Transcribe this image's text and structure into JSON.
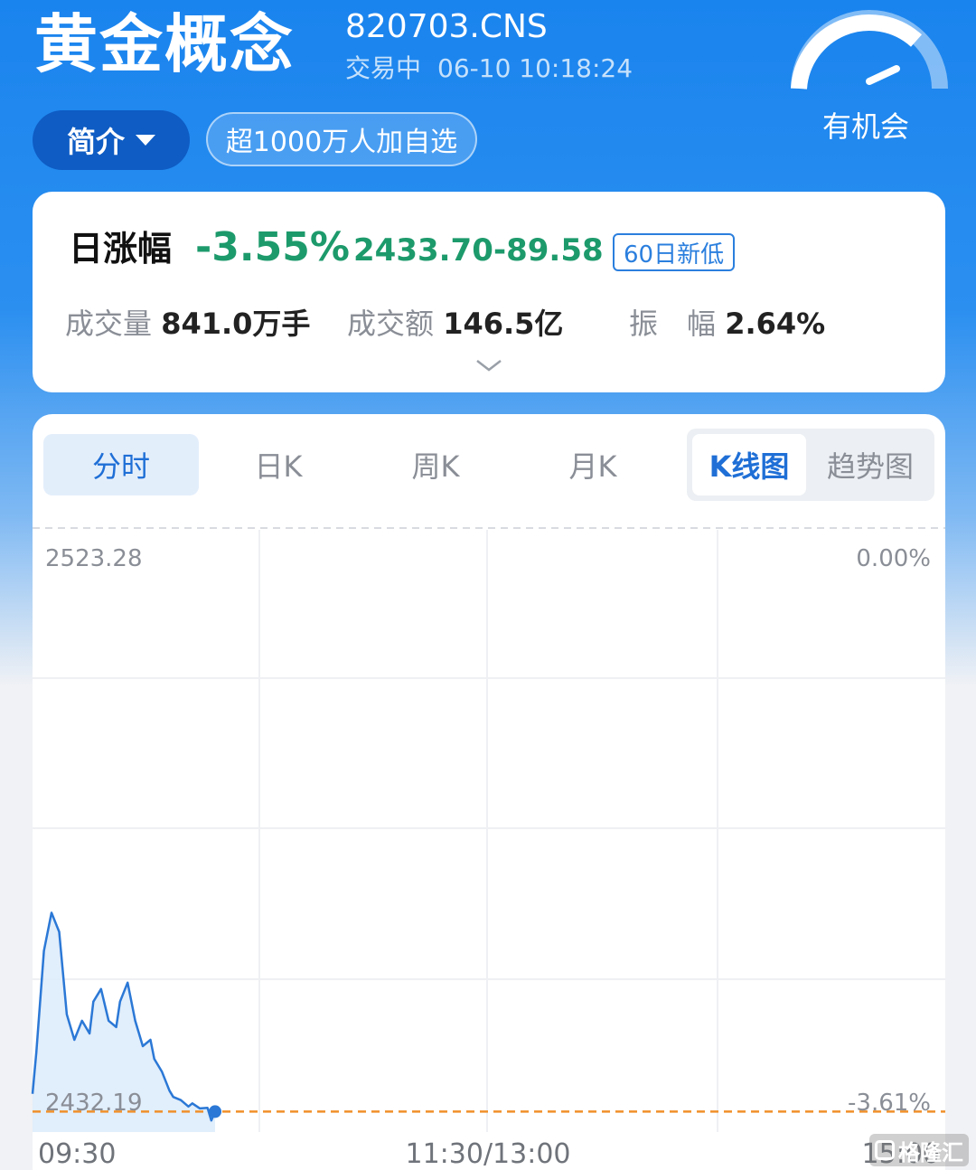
{
  "header": {
    "title": "黄金概念",
    "code": "820703.CNS",
    "trade_status": "交易中",
    "datetime": "06-10 10:18:24",
    "gauge_label": "有机会",
    "intro_button": "简介",
    "watch_badge": "超1000万人加自选"
  },
  "quote": {
    "label": "日涨幅",
    "change_pct": "-3.55%",
    "price": "2433.70",
    "change": "-89.58",
    "tag": "60日新低",
    "volume_label": "成交量",
    "volume": "841.0万手",
    "amount_label": "成交额",
    "amount": "146.5亿",
    "amplitude_label": "振　幅",
    "amplitude": "2.64%",
    "colors": {
      "down": "#1d9a6c",
      "accent": "#2b7fde"
    }
  },
  "tabs": {
    "items": [
      "分时",
      "日K",
      "周K",
      "月K"
    ],
    "active": "分时",
    "chart_modes": [
      "K线图",
      "趋势图"
    ],
    "active_mode": "K线图"
  },
  "chart_data": {
    "type": "line",
    "title": "",
    "x_ticks": [
      "09:30",
      "11:30/13:00",
      "15:00"
    ],
    "y_left_labels": {
      "top": "2523.28",
      "bottom": "2432.19"
    },
    "y_right_labels": {
      "top": "0.00%",
      "bottom": "-3.61%"
    },
    "ylim": [
      2432.19,
      2523.28
    ],
    "reference_line": 2433.7,
    "series": [
      {
        "x": [
          "09:30",
          "09:31",
          "09:33",
          "09:35",
          "09:37",
          "09:39",
          "09:41",
          "09:43",
          "09:45",
          "09:46",
          "09:48",
          "09:50",
          "09:52",
          "09:53",
          "09:55",
          "09:57",
          "09:59",
          "10:01",
          "10:02",
          "10:04",
          "10:06",
          "10:07",
          "10:09",
          "10:11",
          "10:12",
          "10:14",
          "10:16",
          "10:17",
          "10:18"
        ],
        "values": [
          2436.5,
          2443,
          2459,
          2465,
          2462,
          2449,
          2445,
          2448,
          2446,
          2451,
          2453,
          2448,
          2447,
          2451,
          2454,
          2448,
          2444,
          2445,
          2442,
          2440,
          2437,
          2436,
          2435.5,
          2434.5,
          2435,
          2434.2,
          2434.3,
          2432.3,
          2433.7
        ]
      }
    ],
    "grid": true,
    "colors": {
      "line": "#2b78d6",
      "fill": "#dcebfa",
      "reference": "#f0902a"
    }
  },
  "watermark": "格隆汇"
}
